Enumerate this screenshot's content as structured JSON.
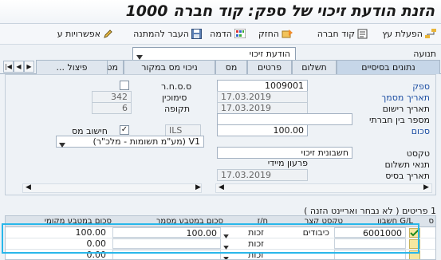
{
  "window": {
    "title": "הזנת הודעת זיכוי של ספק: קוד חברה 1000"
  },
  "toolbar": {
    "activate": "הפעלת עץ",
    "company_code": "קוד חברה",
    "hold": "החזק",
    "simulate": "הדמה",
    "park": "העבר להמתנה",
    "options": "אפשרויות ע"
  },
  "movement": {
    "label": "תנועה",
    "value": "הודעת זיכוי"
  },
  "tabs": [
    "נתונים בסיסיים",
    "תשלום",
    "פרטים",
    "מס",
    "ניכוי מס במקור",
    "מטבע מקומי",
    "פיצול ..."
  ],
  "form": {
    "vendor_label": "ספק",
    "vendor_value": "1009001",
    "doc_date_label": "תאריך מסמך",
    "doc_date_value": "17.03.2019",
    "posting_date_label": "תאריך רישום",
    "posting_date_value": "17.03.2019",
    "cross_cc_label": "מספר בין חברתי",
    "cross_cc_value": "",
    "amount_label": "סכום",
    "amount_value": "100.00",
    "currency": "ILS",
    "calc_tax_label": "חישוב מס",
    "calc_tax_checked": true,
    "tax_code": "V1 (מע\"מ תשומות - מלכ\"ר)",
    "sbr_label": "ס.ס.ח.ר",
    "reference_label": "סימוכין",
    "reference_value": "342",
    "period_label": "תקופה",
    "period_value": "6",
    "text_label": "טקסט",
    "text_value": "חשבונית זיכוי",
    "payment_terms_label": "תנאי תשלום",
    "payment_terms_value": "פרעון מיידי",
    "baseline_date_label": "תאריך בסיס",
    "baseline_date_value": "17.03.2019"
  },
  "items": {
    "label": "1 פריטים ( לא נבחר ואריינט הזנה )",
    "columns": [
      "ס",
      "חשבון G/L",
      "טקסט קצר",
      "ח/ז",
      "סכום במטבע מסמך",
      "סכום במטבע מקומי"
    ],
    "rows": [
      {
        "gl": "6001000",
        "text": "כיבודים",
        "dc": "זכות",
        "doc_amount": "100.00",
        "local_amount": "100.00"
      },
      {
        "gl": "",
        "text": "",
        "dc": "זכות",
        "doc_amount": "",
        "local_amount": "0.00"
      },
      {
        "gl": "",
        "text": "",
        "dc": "זכות",
        "doc_amount": "",
        "local_amount": "0.00"
      }
    ]
  },
  "colors": {
    "required_label": "#1d4fa3",
    "selection_border": "#29b7ea",
    "active_tab": "#c6d6e8"
  }
}
